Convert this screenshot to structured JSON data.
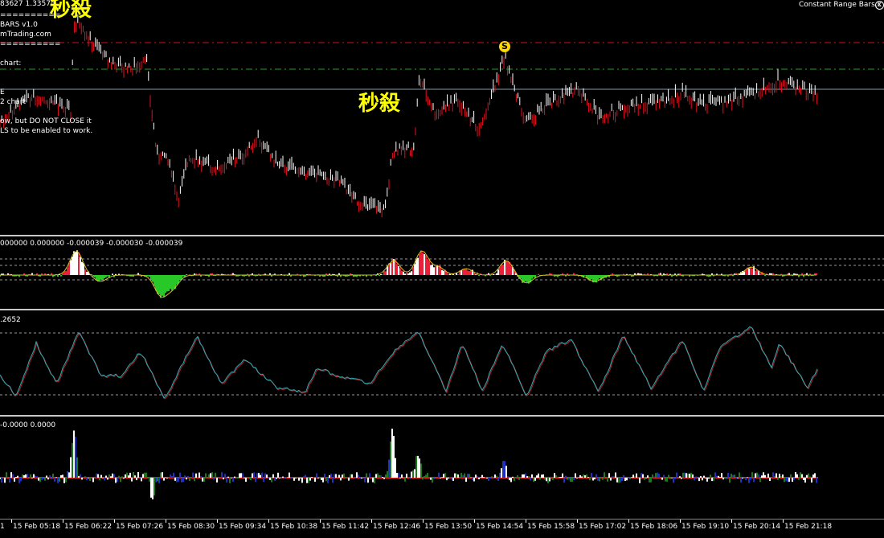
{
  "main_chart": {
    "price_header": "83627 1.33574",
    "indicator_name": "Constant Range Bars.x",
    "info_lines": [
      "==========",
      "BARS v1.0",
      "mTrading.com",
      "==========",
      "",
      "chart:",
      "",
      "",
      "E",
      "2 chart",
      "",
      "ow, but DO NOT CLOSE it",
      "LS to be enabled to work."
    ],
    "annotations": [
      "秒殺",
      "秒殺"
    ],
    "signal_label": "S",
    "colors": {
      "bull": "#ffffff",
      "bear": "#e8101e",
      "resistance": "#d01020",
      "support": "#20a020",
      "hline": "#8a9aa8"
    }
  },
  "sub1": {
    "label": "000000 0.000000 -0.000039 -0.000030 -0.000039"
  },
  "sub2": {
    "label": ".2652"
  },
  "sub3": {
    "label": "-0.0000 0.0000"
  },
  "time_axis": {
    "first": "1",
    "labels": [
      "15 Feb 05:18",
      "15 Feb 06:22",
      "15 Feb 07:26",
      "15 Feb 08:30",
      "15 Feb 09:34",
      "15 Feb 10:38",
      "15 Feb 11:42",
      "15 Feb 12:46",
      "15 Feb 13:50",
      "15 Feb 14:54",
      "15 Feb 15:58",
      "15 Feb 17:02",
      "15 Feb 18:06",
      "15 Feb 19:10",
      "15 Feb 20:14",
      "15 Feb 21:18"
    ]
  }
}
